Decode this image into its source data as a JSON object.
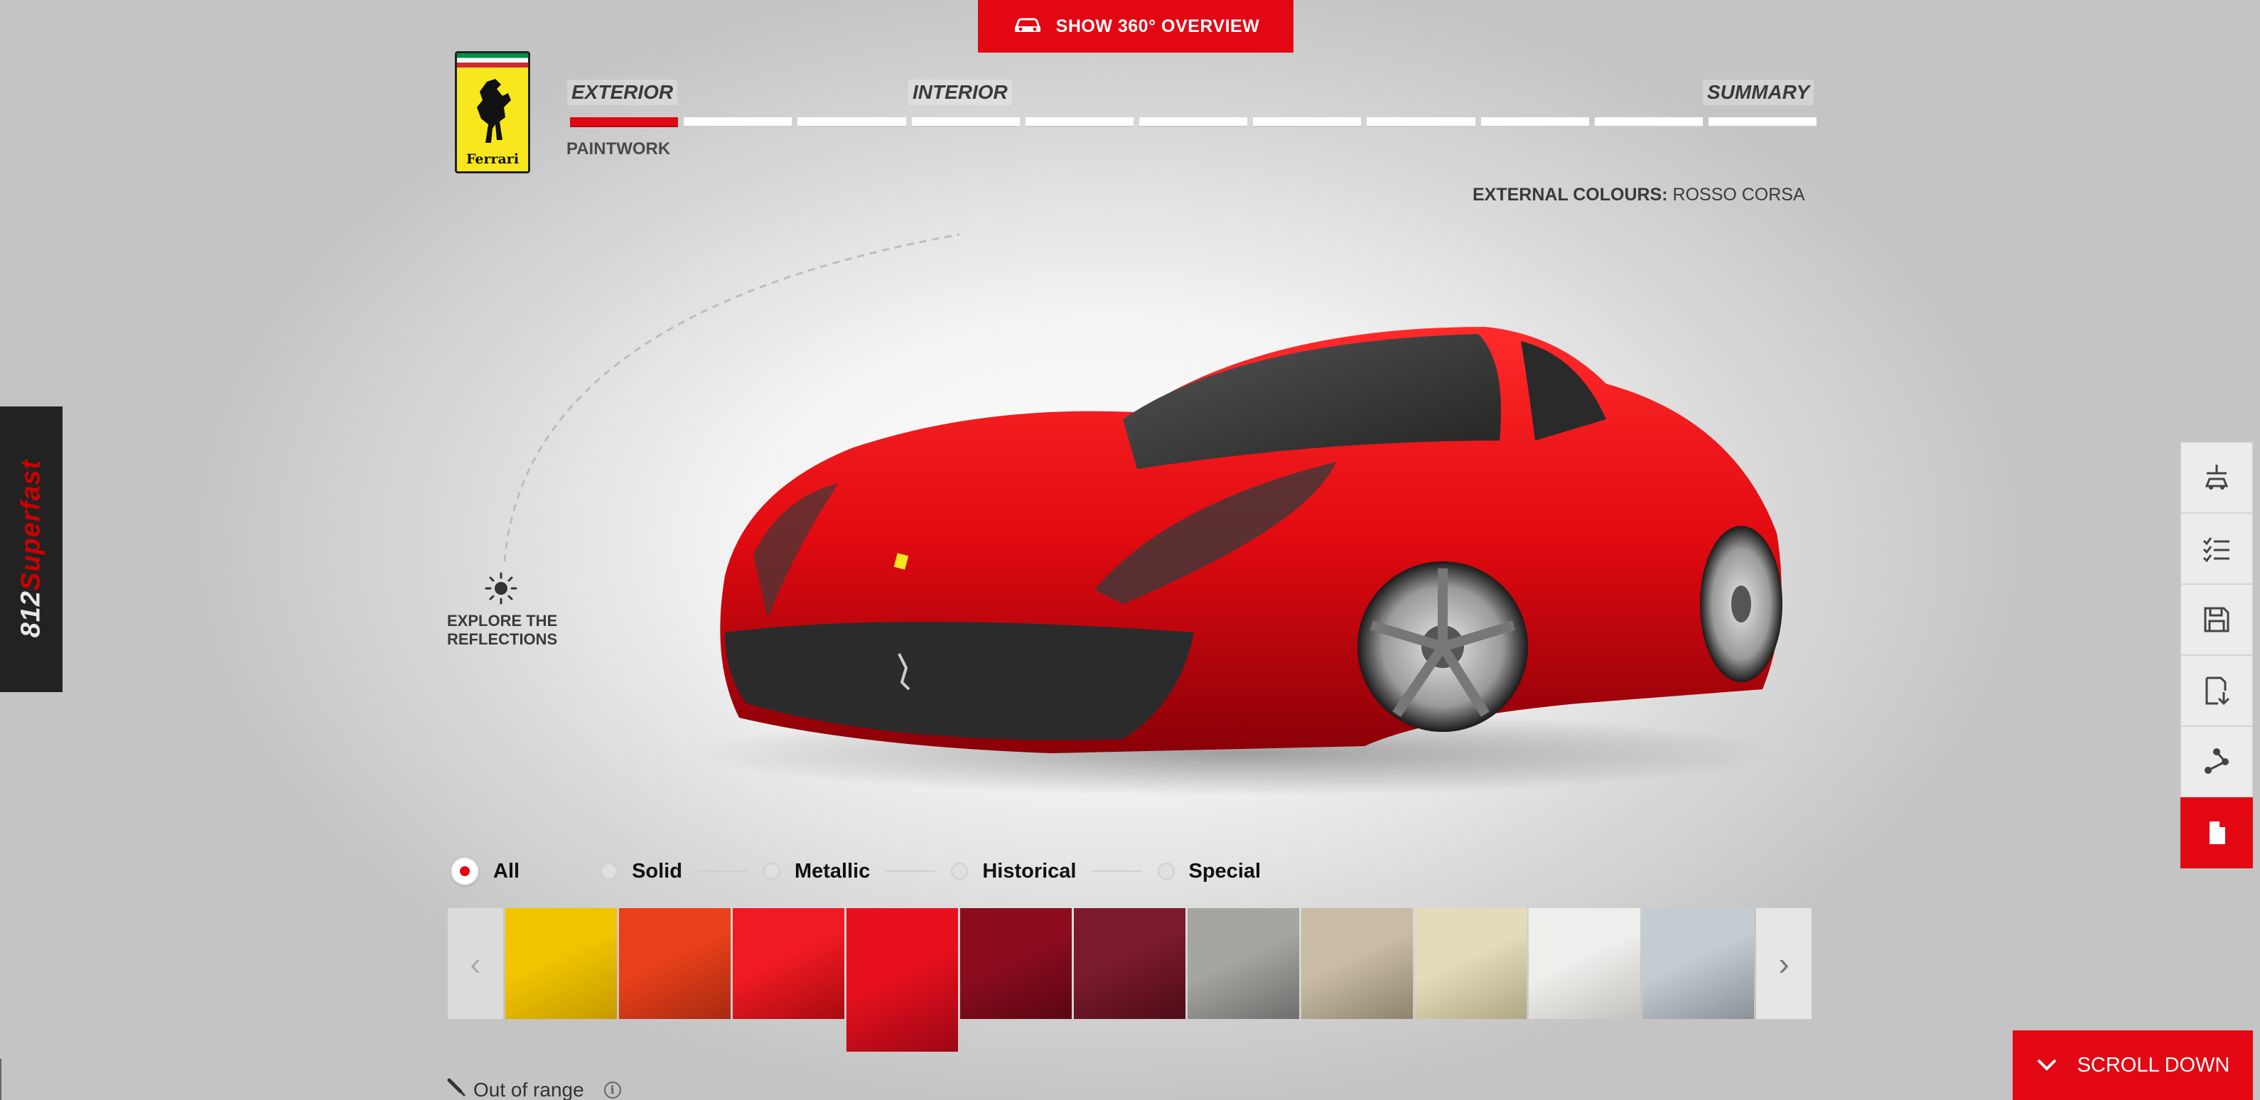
{
  "header": {
    "overview_button_label": "SHOW 360° OVERVIEW",
    "logo_text": "Ferrari"
  },
  "steps": {
    "exterior": "EXTERIOR",
    "interior": "INTERIOR",
    "summary": "SUMMARY",
    "segment_count": 11,
    "active_segment": 1,
    "current_substep": "PAINTWORK"
  },
  "external_colours": {
    "label": "EXTERNAL COLOURS:",
    "value": "ROSSO CORSA"
  },
  "side_tab": {
    "model_number": "812",
    "model_name": "Superfast"
  },
  "reflections": {
    "line1": "EXPLORE THE",
    "line2": "REFLECTIONS"
  },
  "filters": [
    {
      "label": "All",
      "selected": true
    },
    {
      "label": "Solid",
      "selected": false
    },
    {
      "label": "Metallic",
      "selected": false
    },
    {
      "label": "Historical",
      "selected": false
    },
    {
      "label": "Special",
      "selected": false
    }
  ],
  "swatches": [
    {
      "color": "#f0c400",
      "shade": "#c79a00",
      "selected": false
    },
    {
      "color": "#e8401a",
      "shade": "#a82a10",
      "selected": false
    },
    {
      "color": "#f01a22",
      "shade": "#a80a10",
      "selected": false
    },
    {
      "color": "#e8101e",
      "shade": "#9c0614",
      "selected": true
    },
    {
      "color": "#8c0c1e",
      "shade": "#5a0612",
      "selected": false
    },
    {
      "color": "#7a1a2c",
      "shade": "#4e0c18",
      "selected": false
    },
    {
      "color": "#a5a5a2",
      "shade": "#6e6e6c",
      "selected": false
    },
    {
      "color": "#c8bca4",
      "shade": "#8e846e",
      "selected": false
    },
    {
      "color": "#e4dcb8",
      "shade": "#b0a884",
      "selected": false
    },
    {
      "color": "#eeeeec",
      "shade": "#c4c2be",
      "selected": false
    },
    {
      "color": "#c4ccd2",
      "shade": "#8a9298",
      "selected": false
    }
  ],
  "out_of_range": {
    "label": "Out of range"
  },
  "scroll_down": {
    "label": "SCROLL DOWN"
  },
  "right_tools": [
    {
      "icon": "car-view-icon"
    },
    {
      "icon": "checklist-icon"
    },
    {
      "icon": "save-icon"
    },
    {
      "icon": "download-icon"
    },
    {
      "icon": "share-icon"
    },
    {
      "icon": "pdf-document-icon"
    }
  ],
  "colors": {
    "accent": "#e30613"
  }
}
